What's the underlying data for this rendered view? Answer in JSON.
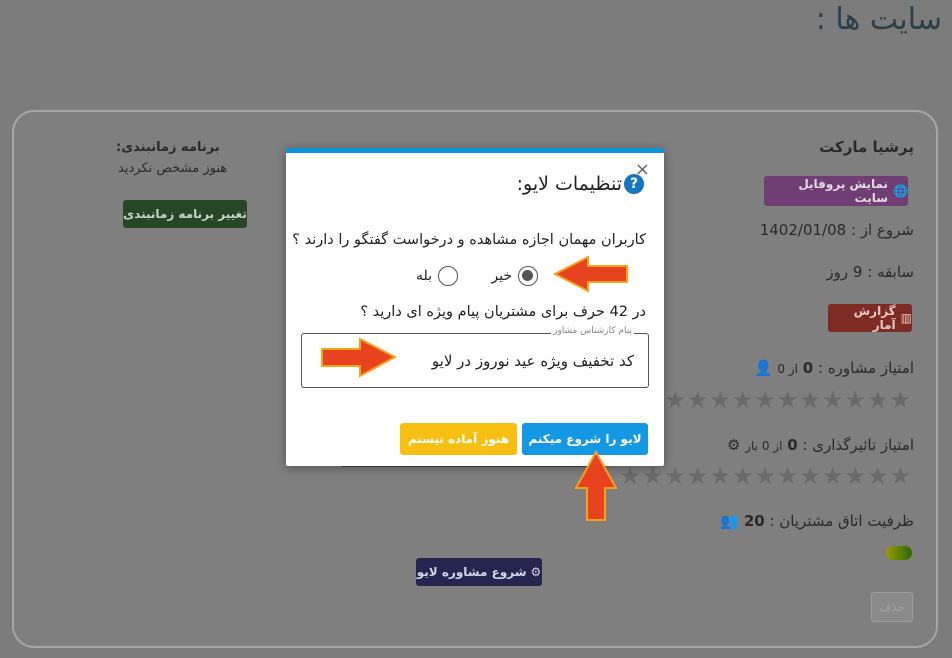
{
  "page": {
    "title": "سایت ها :"
  },
  "site": {
    "name": "پرشیا مارکت",
    "profile_button": "نمایش پروفایل سایت",
    "start_date": "شروع از : 1402/01/08",
    "tenure": "سابقه : 9 روز",
    "report_button": "گزارش آمار",
    "consult_score_label": "امتیاز مشاوره :",
    "consult_score_value": "0",
    "consult_score_suffix": "از 0",
    "impact_score_label": "امتیاز تاثیرگذاری :",
    "impact_score_value": "0",
    "impact_score_suffix": "از 0 بار",
    "capacity_label": "ظرفیت اتاق مشتریان :",
    "capacity_value": "20",
    "delete_button": "حذف",
    "stars": "★★★★★★★★★★★★★",
    "status_colors": [
      "#f5f500",
      "#4cc700"
    ]
  },
  "schedule": {
    "title": "برنامه زمانبندی:",
    "value": "هنوز مشخص نکردید",
    "change_button": "تغییر برنامه زمانبندی"
  },
  "live_consult_button": "شروع مشاوره لایو",
  "modal": {
    "title": "تنظیمات لایو:",
    "close": "×",
    "question_mark": "?",
    "question1": "کاربران مهمان اجازه مشاهده و درخواست گفتگو را دارند ؟",
    "option_no": "خیر",
    "option_yes": "بله",
    "selected": "خیر",
    "question2": "در 42 حرف برای مشتریان پیام ویژه ای دارید ؟",
    "message_legend": "پیام کارشناس مشاور",
    "message_value": "کد تخفیف ویژه عید نوروز در لایو",
    "start_button": "لایو را شروع میکنم",
    "not_ready_button": "هنوز آماده نیستم",
    "accent_color": "#0f93d8"
  },
  "annotation_color": "#e8431f"
}
